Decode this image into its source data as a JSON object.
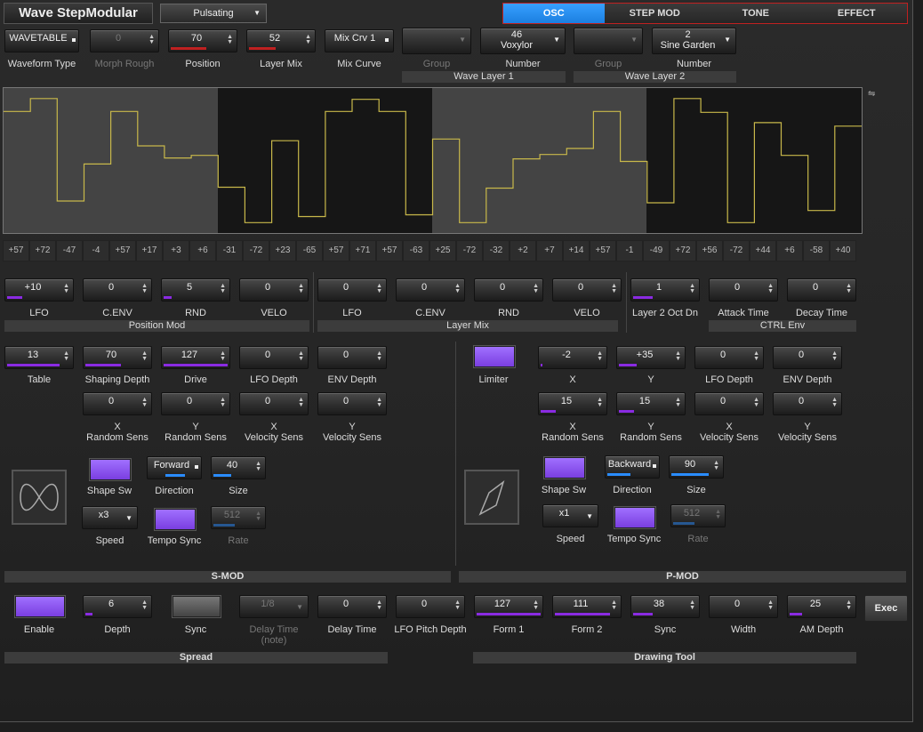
{
  "header": {
    "title": "Wave StepModular",
    "preset": "Pulsating",
    "tabs": [
      "OSC",
      "STEP MOD",
      "TONE",
      "EFFECT"
    ],
    "active_tab": 0
  },
  "top": {
    "waveform_type": "WAVETABLE",
    "waveform_type_label": "Waveform Type",
    "morph_rough": "0",
    "morph_rough_label": "Morph Rough",
    "position": "70",
    "position_label": "Position",
    "layer_mix": "52",
    "layer_mix_label": "Layer Mix",
    "mix_curve": "Mix Crv 1",
    "mix_curve_label": "Mix Curve",
    "wl1_group_label": "Group",
    "wl1_number_line1": "46",
    "wl1_number_line2": "Voxylor",
    "wl1_number_label": "Number",
    "wl1_title": "Wave Layer 1",
    "wl2_group_label": "Group",
    "wl2_number_line1": "2",
    "wl2_number_line2": "Sine Garden",
    "wl2_number_label": "Number",
    "wl2_title": "Wave Layer 2"
  },
  "steps": [
    "+57",
    "+72",
    "-47",
    "-4",
    "+57",
    "+17",
    "+3",
    "+6",
    "-31",
    "-72",
    "+23",
    "-65",
    "+57",
    "+71",
    "+57",
    "-63",
    "+25",
    "-72",
    "-32",
    "+2",
    "+7",
    "+14",
    "+57",
    "-1",
    "-49",
    "+72",
    "+56",
    "-72",
    "+44",
    "+6",
    "-58",
    "+40"
  ],
  "mod": {
    "pos": [
      {
        "v": "+10",
        "l": "LFO"
      },
      {
        "v": "0",
        "l": "C.ENV"
      },
      {
        "v": "5",
        "l": "RND"
      },
      {
        "v": "0",
        "l": "VELO"
      }
    ],
    "pos_title": "Position Mod",
    "mix": [
      {
        "v": "0",
        "l": "LFO"
      },
      {
        "v": "0",
        "l": "C.ENV"
      },
      {
        "v": "0",
        "l": "RND"
      },
      {
        "v": "0",
        "l": "VELO"
      }
    ],
    "mix_title": "Layer Mix",
    "ctrl": [
      {
        "v": "1",
        "l": "Layer 2 Oct Dn"
      },
      {
        "v": "0",
        "l": "Attack Time"
      },
      {
        "v": "0",
        "l": "Decay Time"
      }
    ],
    "ctrl_title": "CTRL Env"
  },
  "smod": {
    "row1": [
      {
        "v": "13",
        "l": "Table"
      },
      {
        "v": "70",
        "l": "Shaping Depth"
      },
      {
        "v": "127",
        "l": "Drive"
      },
      {
        "v": "0",
        "l": "LFO Depth"
      },
      {
        "v": "0",
        "l": "ENV Depth"
      }
    ],
    "row2": [
      {
        "v": "0",
        "l1": "X",
        "l2": "Random Sens"
      },
      {
        "v": "0",
        "l1": "Y",
        "l2": "Random Sens"
      },
      {
        "v": "0",
        "l1": "X",
        "l2": "Velocity Sens"
      },
      {
        "v": "0",
        "l1": "Y",
        "l2": "Velocity Sens"
      }
    ],
    "shape_sw": "Shape Sw",
    "direction": "Forward",
    "direction_label": "Direction",
    "size": "40",
    "size_label": "Size",
    "speed": "x3",
    "speed_label": "Speed",
    "tempo_sync": "Tempo Sync",
    "rate": "512",
    "rate_label": "Rate",
    "title": "S-MOD"
  },
  "pmod": {
    "limiter": "Limiter",
    "row1": [
      {
        "v": "-2",
        "l": "X"
      },
      {
        "v": "+35",
        "l": "Y"
      },
      {
        "v": "0",
        "l": "LFO Depth"
      },
      {
        "v": "0",
        "l": "ENV Depth"
      }
    ],
    "row2": [
      {
        "v": "15",
        "l1": "X",
        "l2": "Random Sens"
      },
      {
        "v": "15",
        "l1": "Y",
        "l2": "Random Sens"
      },
      {
        "v": "0",
        "l1": "X",
        "l2": "Velocity Sens"
      },
      {
        "v": "0",
        "l1": "Y",
        "l2": "Velocity Sens"
      }
    ],
    "shape_sw": "Shape Sw",
    "direction": "Backward",
    "direction_label": "Direction",
    "size": "90",
    "size_label": "Size",
    "speed": "x1",
    "speed_label": "Speed",
    "tempo_sync": "Tempo Sync",
    "rate": "512",
    "rate_label": "Rate",
    "title": "P-MOD"
  },
  "bottom": {
    "enable": "Enable",
    "depth": "6",
    "depth_label": "Depth",
    "sync": "Sync",
    "delay_note": "1/8",
    "delay_note_label1": "Delay Time",
    "delay_note_label2": "(note)",
    "delay_time": "0",
    "delay_time_label": "Delay Time",
    "lfo_pitch": "0",
    "lfo_pitch_label": "LFO Pitch Depth",
    "form1": "127",
    "form1_label": "Form 1",
    "form2": "111",
    "form2_label": "Form 2",
    "dsync": "38",
    "dsync_label": "Sync",
    "width": "0",
    "width_label": "Width",
    "am": "25",
    "am_label": "AM Depth",
    "exec": "Exec",
    "spread_title": "Spread",
    "drawing_title": "Drawing Tool"
  }
}
